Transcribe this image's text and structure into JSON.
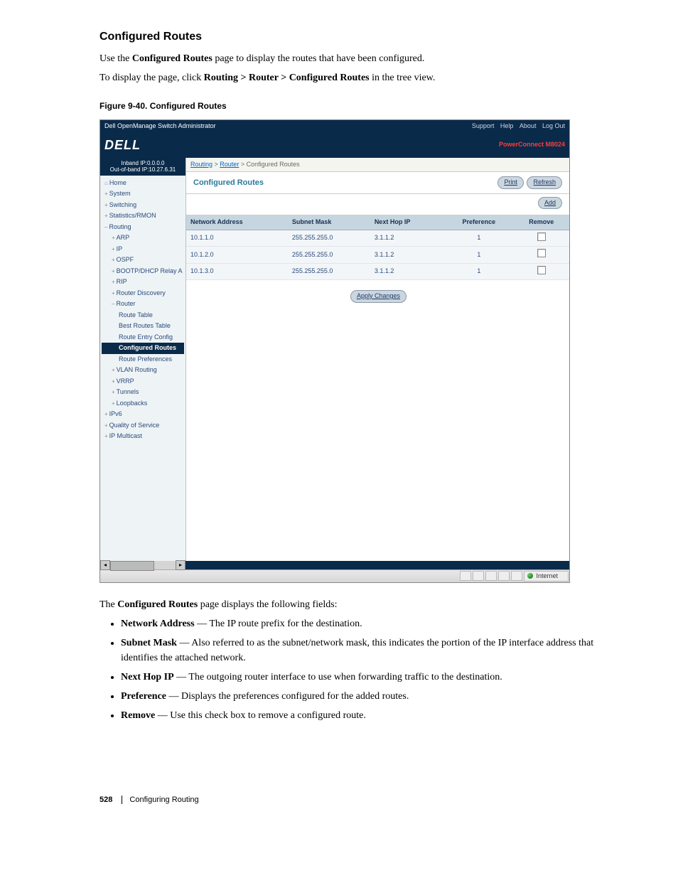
{
  "heading": "Configured Routes",
  "intro_1a": "Use the ",
  "intro_1b": "Configured Routes",
  "intro_1c": " page to display the routes that have been configured.",
  "intro_2": "To display the page, click ",
  "intro_path": "Routing > Router > Configured Routes",
  "intro_2b": " in the tree view.",
  "figcap": "Figure 9-40.    Configured Routes",
  "titlebar": {
    "left": "Dell OpenManage Switch Administrator",
    "links": {
      "support": "Support",
      "help": "Help",
      "about": "About",
      "logout": "Log Out"
    }
  },
  "brand": {
    "logo": "DELL",
    "product": "PowerConnect M8024"
  },
  "ipinfo": {
    "inband": "Inband IP:0.0.0.0",
    "oob": "Out-of-band IP:10.27.6.31"
  },
  "tree": {
    "home": "Home",
    "system": "System",
    "switching": "Switching",
    "stats": "Statistics/RMON",
    "routing": "Routing",
    "arp": "ARP",
    "ip": "IP",
    "ospf": "OSPF",
    "bootp": "BOOTP/DHCP Relay A",
    "rip": "RIP",
    "router_disc": "Router Discovery",
    "router": "Router",
    "route_table": "Route Table",
    "best_routes": "Best Routes Table",
    "route_entry": "Route Entry Config",
    "configured_routes": "Configured Routes",
    "route_prefs": "Route Preferences",
    "vlan_routing": "VLAN Routing",
    "vrrp": "VRRP",
    "tunnels": "Tunnels",
    "loopbacks": "Loopbacks",
    "ipv6": "IPv6",
    "qos": "Quality of Service",
    "ipmulti": "IP Multicast"
  },
  "bc": {
    "a": "Routing",
    "b": "Router",
    "c": "Configured Routes"
  },
  "panel": {
    "title": "Configured Routes",
    "print": "Print",
    "refresh": "Refresh",
    "add": "Add",
    "apply": "Apply Changes"
  },
  "table": {
    "headers": {
      "net": "Network Address",
      "mask": "Subnet Mask",
      "next": "Next Hop IP",
      "pref": "Preference",
      "remove": "Remove"
    },
    "rows": [
      {
        "net": "10.1.1.0",
        "mask": "255.255.255.0",
        "next": "3.1.1.2",
        "pref": "1"
      },
      {
        "net": "10.1.2.0",
        "mask": "255.255.255.0",
        "next": "3.1.1.2",
        "pref": "1"
      },
      {
        "net": "10.1.3.0",
        "mask": "255.255.255.0",
        "next": "3.1.1.2",
        "pref": "1"
      }
    ]
  },
  "status_internet": "Internet",
  "after_text": {
    "lead_a": "The ",
    "lead_b": "Configured Routes",
    "lead_c": " page displays the following fields:",
    "f1_b": "Network Address",
    "f1_t": " — The IP route prefix for the destination.",
    "f2_b": "Subnet Mask",
    "f2_t": " — Also referred to as the subnet/network mask, this indicates the portion of the IP interface address that identifies the attached network.",
    "f3_b": "Next Hop IP",
    "f3_t": " — The outgoing router interface to use when forwarding traffic to the destination.",
    "f4_b": "Preference",
    "f4_t": " — Displays the preferences configured for the added routes.",
    "f5_b": "Remove",
    "f5_t": " — Use this check box to remove a configured route."
  },
  "footer": {
    "page": "528",
    "section": "Configuring Routing"
  }
}
